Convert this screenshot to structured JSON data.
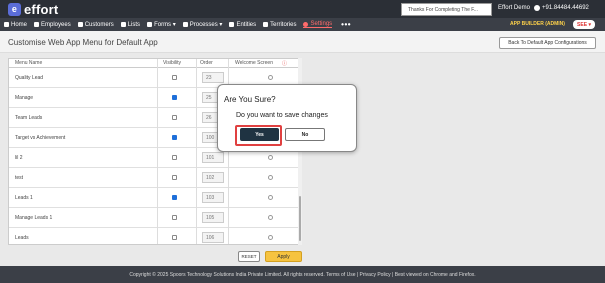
{
  "header": {
    "logo_text": "effort",
    "logo_mark": "e",
    "notice": "Thanks For Completing The F...",
    "account_name": "Effort Demo",
    "phone": "+91.84484.44692"
  },
  "nav": {
    "items": [
      {
        "label": "Home",
        "icon": "home-icon"
      },
      {
        "label": "Employees",
        "icon": "person-icon"
      },
      {
        "label": "Customers",
        "icon": "people-icon"
      },
      {
        "label": "Lists",
        "icon": "list-icon"
      },
      {
        "label": "Forms ▾",
        "icon": "form-icon"
      },
      {
        "label": "Processes ▾",
        "icon": "process-icon"
      },
      {
        "label": "Entities",
        "icon": "entity-icon"
      },
      {
        "label": "Territories",
        "icon": "location-icon"
      },
      {
        "label": "Settings",
        "icon": "gear-icon"
      }
    ],
    "more": "•••",
    "app_builder": "APP BUILDER (ADMIN)",
    "user_badge": "SEE ▾"
  },
  "page": {
    "title": "Customise Web App Menu for Default App",
    "back_button": "Back To Default App Configurations"
  },
  "table": {
    "headers": {
      "name": "Menu Name",
      "visibility": "Visibility",
      "order": "Order",
      "welcome": "Welcome Screen"
    },
    "rows": [
      {
        "name": "Quality Lead",
        "checked": false,
        "order": "23"
      },
      {
        "name": "Manage",
        "checked": true,
        "order": "25"
      },
      {
        "name": "Team Leads",
        "checked": false,
        "order": "26"
      },
      {
        "name": "Target vs Achievement",
        "checked": true,
        "order": "100"
      },
      {
        "name": "lil 2",
        "checked": false,
        "order": "101"
      },
      {
        "name": "test",
        "checked": false,
        "order": "102"
      },
      {
        "name": "Leads 1",
        "checked": true,
        "order": "103"
      },
      {
        "name": "Manage Leads 1",
        "checked": false,
        "order": "105"
      },
      {
        "name": "Leads",
        "checked": false,
        "order": "106"
      }
    ]
  },
  "actions": {
    "reset": "RESET",
    "apply": "Apply"
  },
  "modal": {
    "title": "Are You Sure?",
    "message": "Do you want to save changes",
    "yes": "Yes",
    "no": "No"
  },
  "footer": {
    "text": "Copyright © 2025 Spoors Technology Solutions India Private Limited. All rights reserved. Terms of Use | Privacy Policy | Best viewed on Chrome and Firefox."
  },
  "colors": {
    "topbar": "#2b2f36",
    "navbar": "#3b3f47",
    "active_nav": "#ff6b6b",
    "apply": "#f6c340",
    "yes_button": "#1f3342",
    "highlight": "#e04040"
  }
}
